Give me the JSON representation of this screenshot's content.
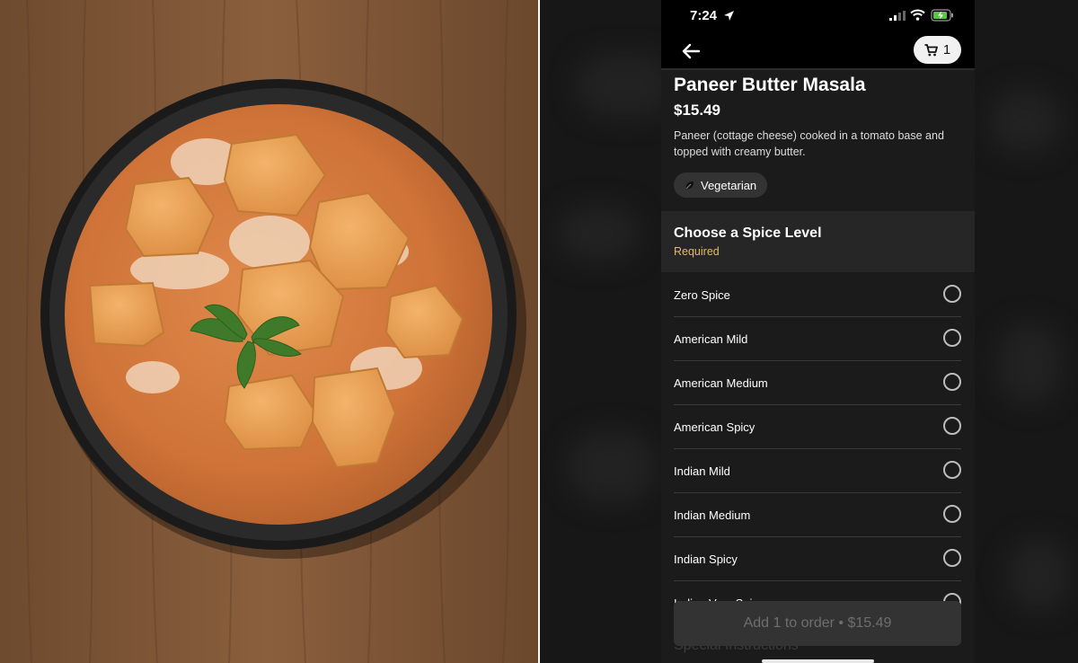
{
  "status_bar": {
    "time": "7:24"
  },
  "icons": {
    "back": "arrow-left-icon",
    "cart": "shopping-cart-icon",
    "location": "location-arrow-icon",
    "signal": "cellular-signal-icon",
    "wifi": "wifi-icon",
    "battery": "battery-charging-icon",
    "vegetarian": "leaf-icon"
  },
  "cart": {
    "count": "1"
  },
  "item": {
    "name": "Paneer Butter Masala",
    "price": "$15.49",
    "description": "Paneer (cottage cheese) cooked in a tomato base and topped with creamy butter.",
    "badge": "Vegetarian"
  },
  "spice_section": {
    "title": "Choose a Spice Level",
    "requirement": "Required",
    "options": [
      "Zero Spice",
      "American Mild",
      "American Medium",
      "American Spicy",
      "Indian Mild",
      "Indian Medium",
      "Indian Spicy",
      "Indian Very Spicy"
    ]
  },
  "footer": {
    "add_button": "Add 1 to order • $15.49",
    "next_section": "Special Instructions"
  },
  "colors": {
    "background": "#000000",
    "panel": "#1b1b1b",
    "section_header": "#262626",
    "required_accent": "#e7b969",
    "disabled_button": "#333333",
    "disabled_text": "#6e6e6e"
  }
}
